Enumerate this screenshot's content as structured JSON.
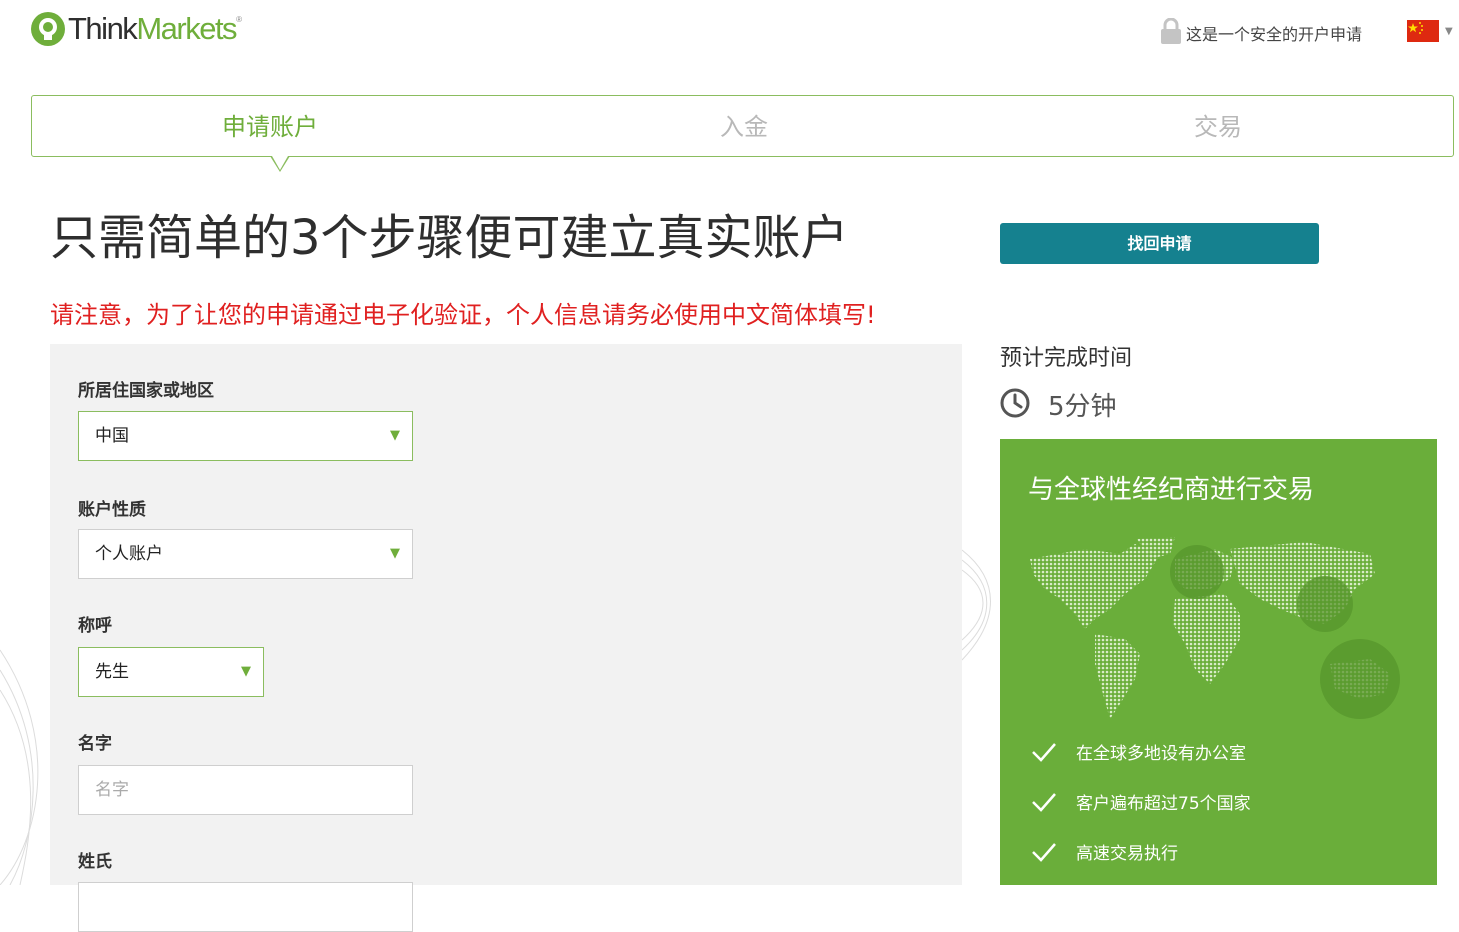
{
  "header": {
    "logo_think": "Think",
    "logo_markets": "Markets",
    "logo_reg": "®",
    "secure_text": "这是一个安全的开户申请"
  },
  "steps": [
    {
      "label": "申请账户",
      "active": true
    },
    {
      "label": "入金",
      "active": false
    },
    {
      "label": "交易",
      "active": false
    }
  ],
  "title": "只需简单的3个步骤便可建立真实账户",
  "notice": "请注意，为了让您的申请通过电子化验证，个人信息请务必使用中文简体填写!",
  "form": {
    "country_label": "所居住国家或地区",
    "country_value": "中国",
    "account_type_label": "账户性质",
    "account_type_value": "个人账户",
    "salutation_label": "称呼",
    "salutation_value": "先生",
    "first_name_label": "名字",
    "first_name_placeholder": "名字",
    "last_name_label": "姓氏"
  },
  "sidebar": {
    "retrieve_button": "找回申请",
    "estimate_label": "预计完成时间",
    "estimate_time": "5分钟",
    "promo_title": "与全球性经纪商进行交易",
    "features": [
      "在全球多地设有办公室",
      "客户遍布超过75个国家",
      "高速交易执行"
    ]
  },
  "colors": {
    "brand_green": "#6fae3b",
    "button_teal": "#15818f",
    "notice_red": "#e02020",
    "promo_green": "#6aae3a"
  }
}
